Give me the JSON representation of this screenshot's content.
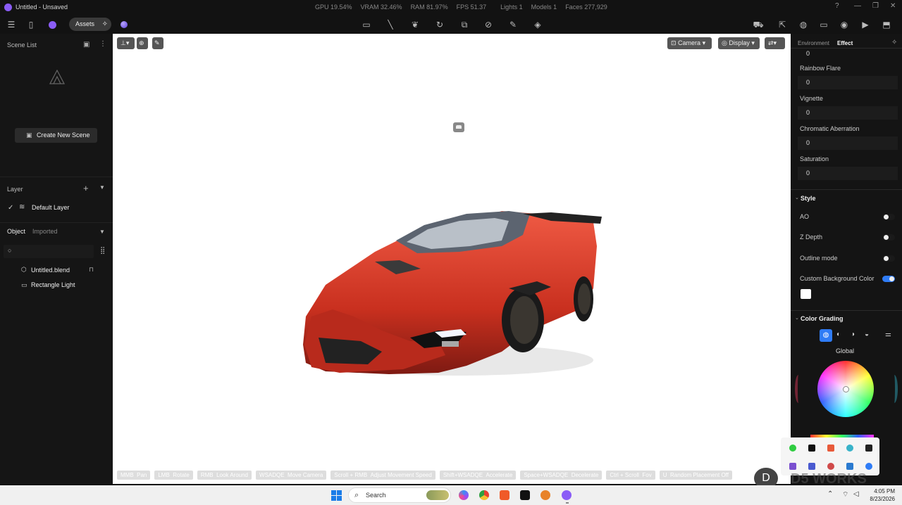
{
  "titlebar": {
    "title": "Untitled - Unsaved",
    "stats": [
      "GPU 19.54%",
      "VRAM 32.46%",
      "RAM 81.97%",
      "FPS 51.37",
      "Lights 1",
      "Models 1",
      "Faces 277,929"
    ]
  },
  "toolbar": {
    "assets_label": "Assets"
  },
  "left": {
    "scene_list_title": "Scene List",
    "create_scene_label": "Create New Scene",
    "layer_title": "Layer",
    "default_layer": "Default Layer",
    "object_tab": "Object",
    "imported_tab": "Imported",
    "objects": [
      "Untitled.blend",
      "Rectangle Light"
    ]
  },
  "viewport": {
    "camera_label": "Camera",
    "display_label": "Display",
    "hints": [
      {
        "key": "MMB",
        "action": "Pan"
      },
      {
        "key": "LMB",
        "action": "Rotate"
      },
      {
        "key": "RMB",
        "action": "Look Around"
      },
      {
        "key": "WSADQE",
        "action": "Move Camera"
      },
      {
        "key": "Scroll + RMB",
        "action": "Adjust Movement Speed"
      },
      {
        "key": "Shift+WSADQE",
        "action": "Accelerate"
      },
      {
        "key": "Space+WSADQE",
        "action": "Decelerate"
      },
      {
        "key": "Ctrl + Scroll",
        "action": "Fov"
      },
      {
        "key": "U",
        "action": "Random Placement Off"
      }
    ]
  },
  "right": {
    "tab_environment": "Environment",
    "tab_effect": "Effect",
    "top_value": "0",
    "rainbow_flare_label": "Rainbow Flare",
    "rainbow_flare_value": "0",
    "vignette_label": "Vignette",
    "vignette_value": "0",
    "chromatic_label": "Chromatic Aberration",
    "chromatic_value": "0",
    "saturation_label": "Saturation",
    "saturation_value": "0",
    "style_section": "Style",
    "ao_label": "AO",
    "zdepth_label": "Z Depth",
    "outline_label": "Outline mode",
    "custom_bg_label": "Custom Background Color",
    "color_grading_section": "Color Grading",
    "global_label": "Global"
  },
  "taskbar": {
    "search_placeholder": "Search",
    "time": "4:05 PM",
    "date": "8/23/2026",
    "watermark": "D5 WORKS"
  },
  "colors": {
    "accent": "#2f7cf6",
    "brand": "#8a5cf6",
    "car_red": "#d8392a"
  }
}
